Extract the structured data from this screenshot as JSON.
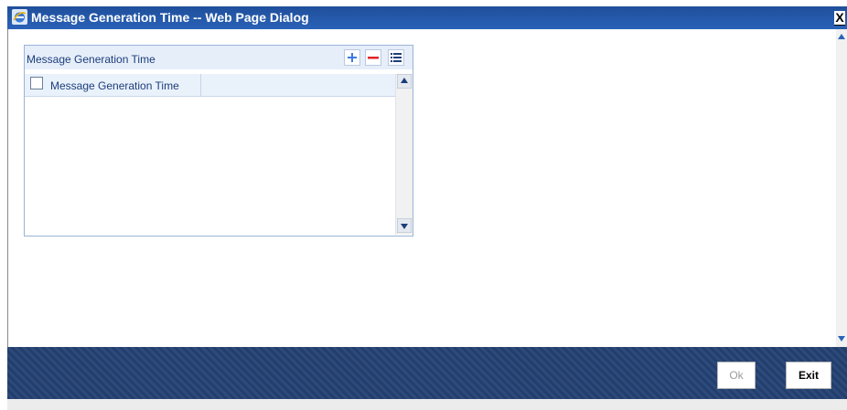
{
  "window": {
    "title": "Message Generation Time -- Web Page Dialog",
    "close_glyph": "X",
    "title_icon": "ie-dialog-icon"
  },
  "grid": {
    "title": "Message Generation Time",
    "toolbar": {
      "add_icon": "plus-icon",
      "delete_icon": "minus-icon",
      "view_icon": "list-icon"
    },
    "columns": [
      "Message Generation Time"
    ],
    "rows": []
  },
  "footer": {
    "ok_label": "Ok",
    "exit_label": "Exit"
  },
  "colors": {
    "title_bar": "#2a62b8",
    "footer": "#2c4a7c",
    "grid_header": "#e6eefa",
    "add_icon": "#3b7be0",
    "delete_icon": "#e0252a"
  }
}
